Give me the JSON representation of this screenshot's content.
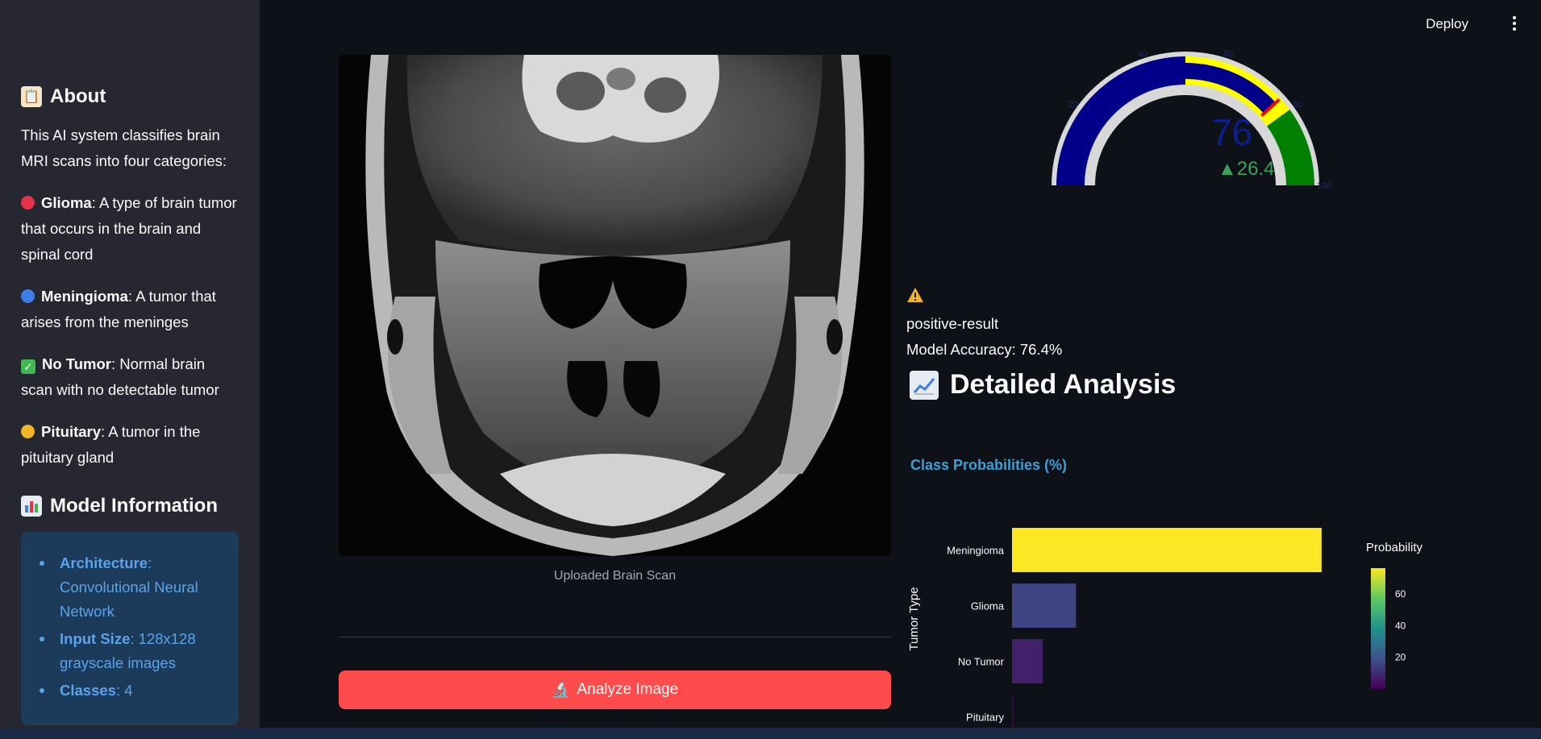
{
  "topbar": {
    "deploy_label": "Deploy"
  },
  "sidebar": {
    "about_heading": "About",
    "about_text": "This AI system classifies brain MRI scans into four categories:",
    "classes": [
      {
        "name": "Glioma",
        "desc": ": A type of brain tumor that occurs in the brain and spinal cord",
        "color": "#e5334b"
      },
      {
        "name": "Meningioma",
        "desc": ": A tumor that arises from the meninges",
        "color": "#3f7de6"
      },
      {
        "name": "No Tumor",
        "desc": ": Normal brain scan with no detectable tumor",
        "color": "#3fb950"
      },
      {
        "name": "Pituitary",
        "desc": ": A tumor in the pituitary gland",
        "color": "#f0b429"
      }
    ],
    "model_heading": "Model Information",
    "model_info": [
      {
        "key": "Architecture",
        "value": ": Convolutional Neural Network"
      },
      {
        "key": "Input Size",
        "value": ": 128x128 grayscale images"
      },
      {
        "key": "Classes",
        "value": ": 4"
      }
    ]
  },
  "main": {
    "scan_caption": "Uploaded Brain Scan",
    "analyze_label": "Analyze Image"
  },
  "gauge": {
    "value": 76.4,
    "value_text": "76",
    "delta_text": "▲26.4",
    "ticks": [
      "0",
      "20",
      "40",
      "60",
      "80",
      "100"
    ],
    "colors": {
      "low": "#00008b",
      "mid": "#ffff00",
      "high": "#008000",
      "threshold": "#ff0000"
    }
  },
  "result": {
    "status": "positive-result",
    "accuracy": "Model Accuracy: 76.4%"
  },
  "analysis": {
    "heading": "Detailed Analysis"
  },
  "chart_data": {
    "type": "bar",
    "orientation": "horizontal",
    "title": "Class Probabilities (%)",
    "ylabel": "Tumor Type",
    "categories": [
      "Meningioma",
      "Glioma",
      "No Tumor",
      "Pituitary"
    ],
    "values": [
      76.4,
      15.8,
      7.6,
      0.2
    ],
    "colorbar_title": "Probability",
    "colorbar_ticks": [
      20,
      40,
      60
    ],
    "colorbar_range": [
      0,
      76.4
    ]
  }
}
